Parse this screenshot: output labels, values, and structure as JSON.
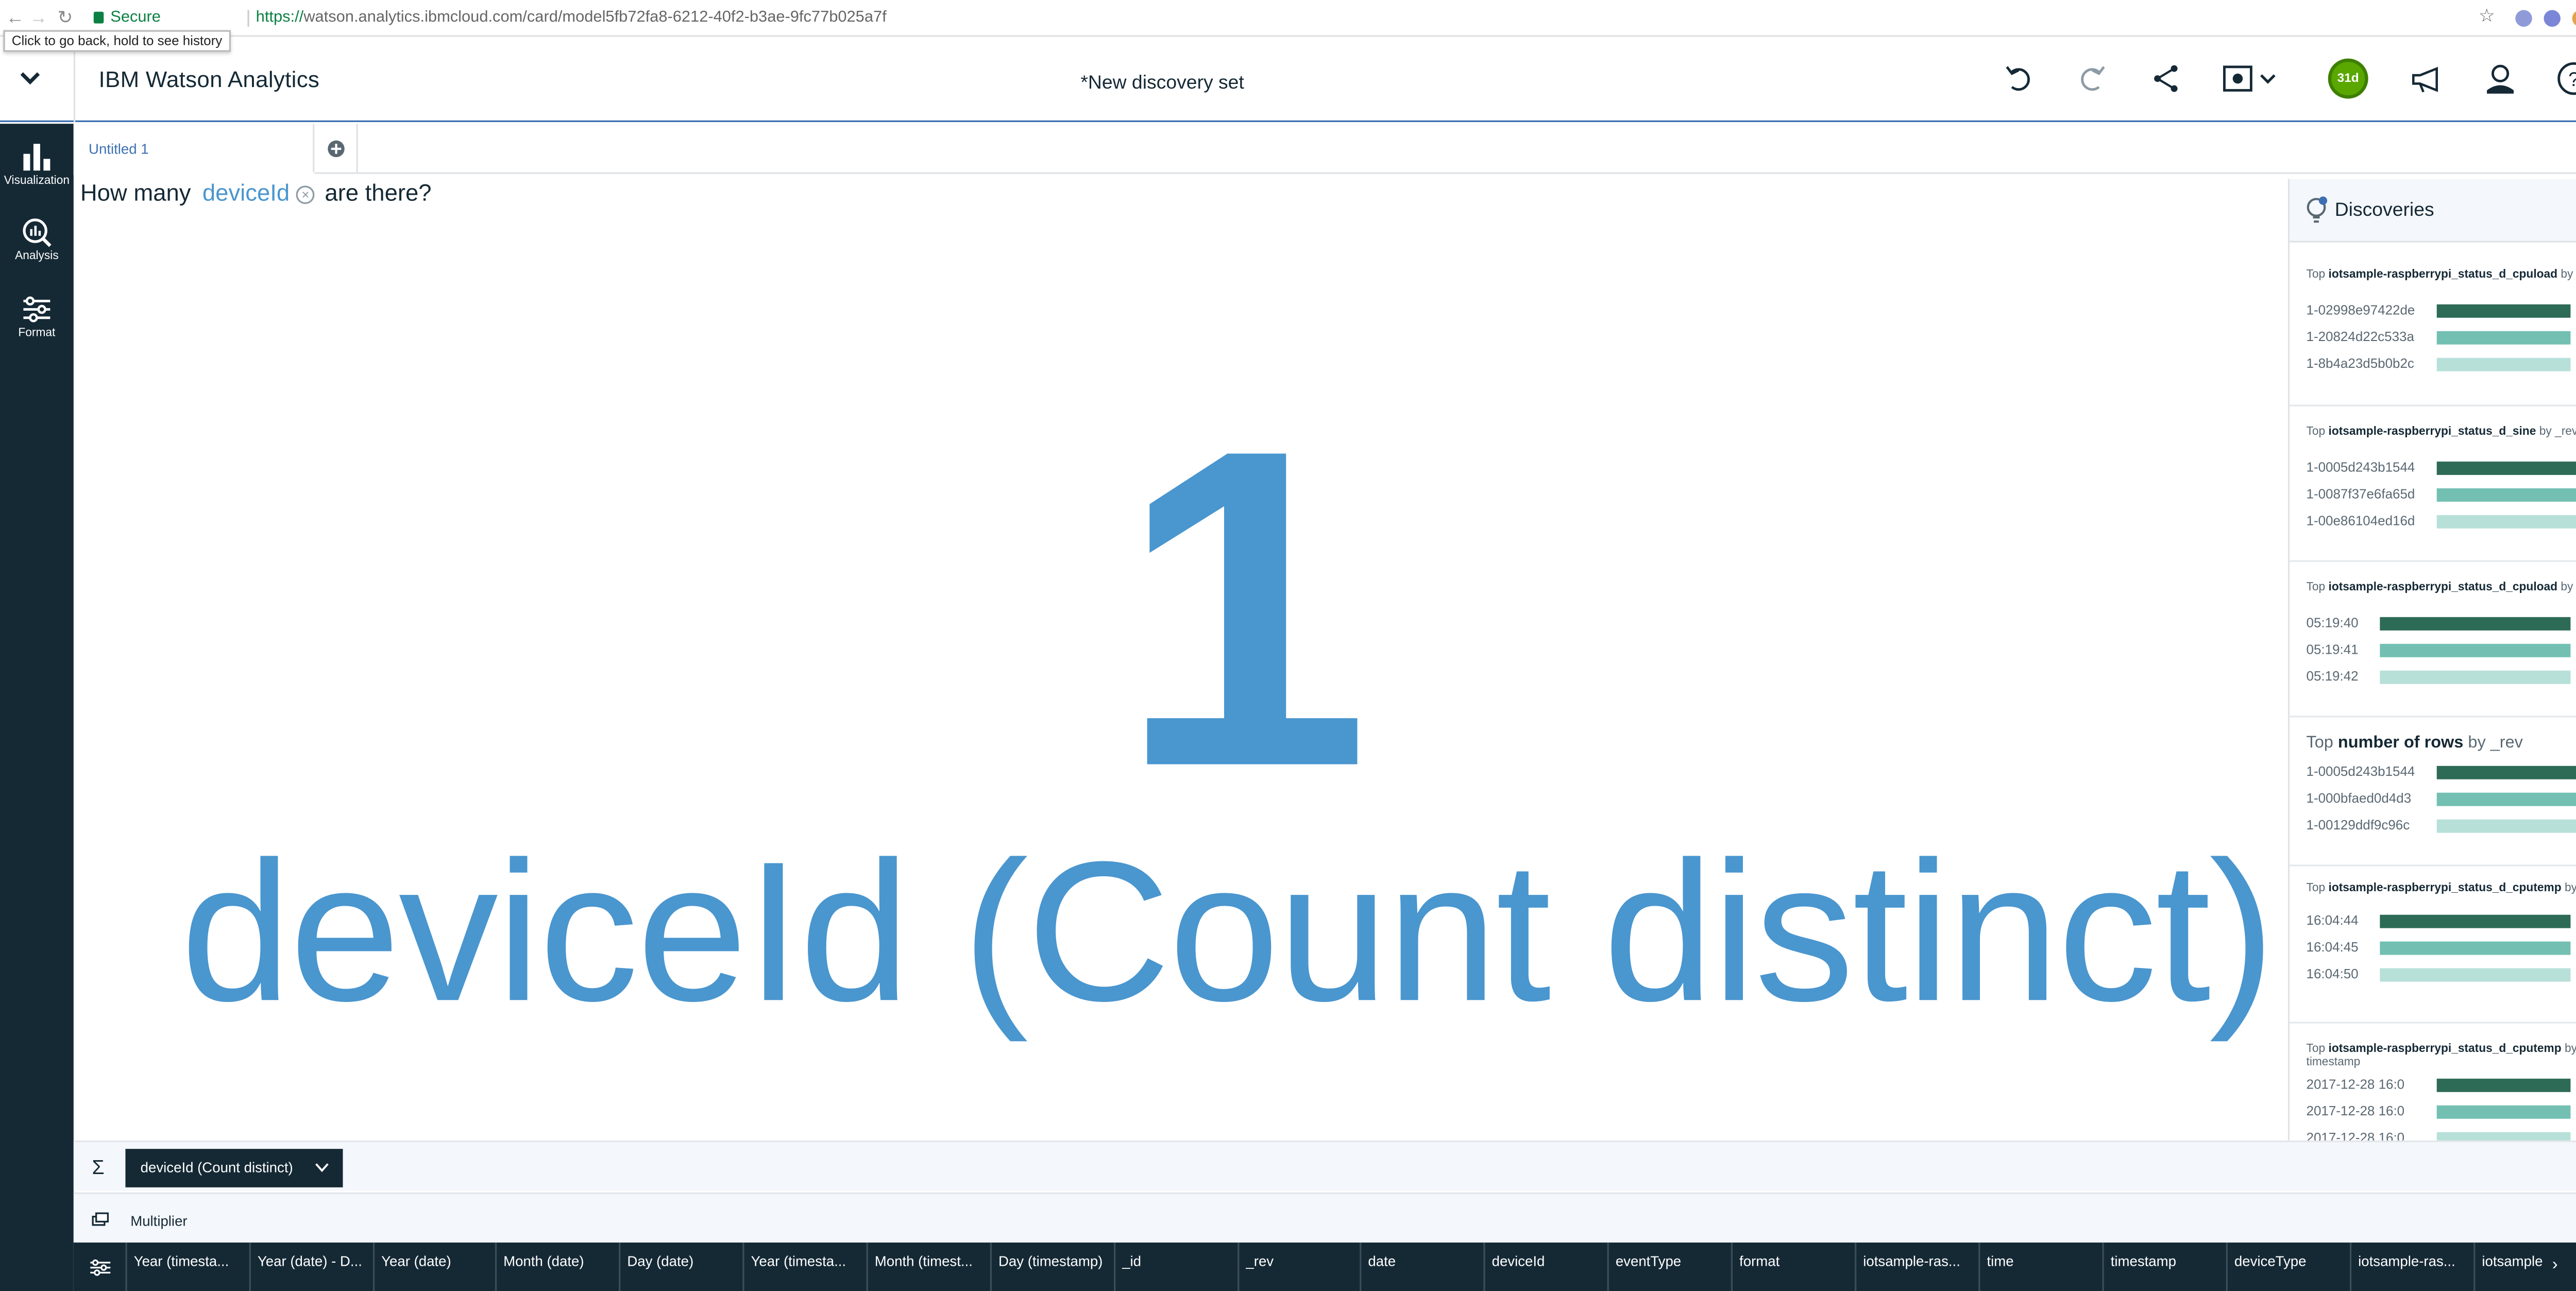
{
  "browser": {
    "secure_label": "Secure",
    "url_scheme": "https://",
    "url_rest": "watson.analytics.ibmcloud.com/card/model5fb72fa8-6212-40f2-b3ae-9fc77b025a7f",
    "tooltip": "Click to go back, hold to see history"
  },
  "header": {
    "app_title": "IBM Watson Analytics",
    "doc_title": "*New discovery set",
    "trial_badge": "31d"
  },
  "leftnav": {
    "items": [
      {
        "label": "Visualization",
        "icon": "bar-chart-icon"
      },
      {
        "label": "Analysis",
        "icon": "analysis-icon"
      },
      {
        "label": "Format",
        "icon": "sliders-icon"
      }
    ]
  },
  "tabs": [
    {
      "label": "Untitled 1",
      "active": true
    }
  ],
  "question": {
    "prefix": "How many",
    "token": "deviceId",
    "suffix": "are there?"
  },
  "visualization": {
    "value": "1",
    "label": "deviceId (Count distinct)",
    "color": "#4a96cf"
  },
  "discoveries": {
    "title": "Discoveries",
    "colors": [
      "#2d6b57",
      "#73c0b3",
      "#b7e0d9"
    ],
    "cards": [
      {
        "title_prefix": "Top",
        "title_bold": "iotsample-raspberrypi_status_d_cpuload",
        "title_suffix": "by _rev",
        "rows": [
          {
            "label": "1-02998e97422de",
            "value": "0.82"
          },
          {
            "label": "1-20824d22c533a",
            "value": "0.82"
          },
          {
            "label": "1-8b4a23d5b0b2c",
            "value": "0.82"
          }
        ]
      },
      {
        "title_prefix": "Top",
        "title_bold": "iotsample-raspberrypi_status_d_sine",
        "title_suffix": "by _rev",
        "rows": [
          {
            "label": "1-0005d243b1544",
            "value": "1"
          },
          {
            "label": "1-0087f37e6fa65d",
            "value": "1"
          },
          {
            "label": "1-00e86104ed16d",
            "value": "1"
          }
        ]
      },
      {
        "title_prefix": "Top",
        "title_bold": "iotsample-raspberrypi_status_d_cpuload",
        "title_suffix": "by time",
        "rows": [
          {
            "label": "05:19:40",
            "value": "0.82"
          },
          {
            "label": "05:19:41",
            "value": "0.82"
          },
          {
            "label": "05:19:42",
            "value": "0.82"
          }
        ]
      },
      {
        "title_prefix": "Top",
        "title_bold": "number of rows",
        "title_suffix": "by _rev",
        "rows": [
          {
            "label": "1-0005d243b1544",
            "value": "1"
          },
          {
            "label": "1-000bfaed0d4d3",
            "value": "1"
          },
          {
            "label": "1-00129ddf9c96c",
            "value": "1"
          }
        ]
      },
      {
        "title_prefix": "Top",
        "title_bold": "iotsample-raspberrypi_status_d_cputemp",
        "title_suffix": "by time",
        "rows": [
          {
            "label": "16:04:44",
            "value": "52.6"
          },
          {
            "label": "16:04:45",
            "value": "52.6"
          },
          {
            "label": "16:04:50",
            "value": "52.6"
          }
        ]
      },
      {
        "title_prefix": "Top",
        "title_bold": "iotsample-raspberrypi_status_d_cputemp",
        "title_suffix": "by timestamp",
        "rows": [
          {
            "label": "2017-12-28 16:0",
            "value": "52.6"
          },
          {
            "label": "2017-12-28 16:0",
            "value": "52.6"
          },
          {
            "label": "2017-12-28 16:0",
            "value": "52.6"
          }
        ]
      }
    ]
  },
  "summary": {
    "sigma": "Σ",
    "pill_label": "deviceId (Count distinct)"
  },
  "multiplier": {
    "label": "Multiplier"
  },
  "columns": [
    "Year (timesta...",
    "Year (date) - D...",
    "Year (date)",
    "Month (date)",
    "Day (date)",
    "Year (timesta...",
    "Month (timest...",
    "Day (timestamp)",
    "_id",
    "_rev",
    "date",
    "deviceId",
    "eventType",
    "format",
    "iotsample-ras...",
    "time",
    "timestamp",
    "deviceType",
    "iotsample-ras...",
    "iotsample"
  ]
}
